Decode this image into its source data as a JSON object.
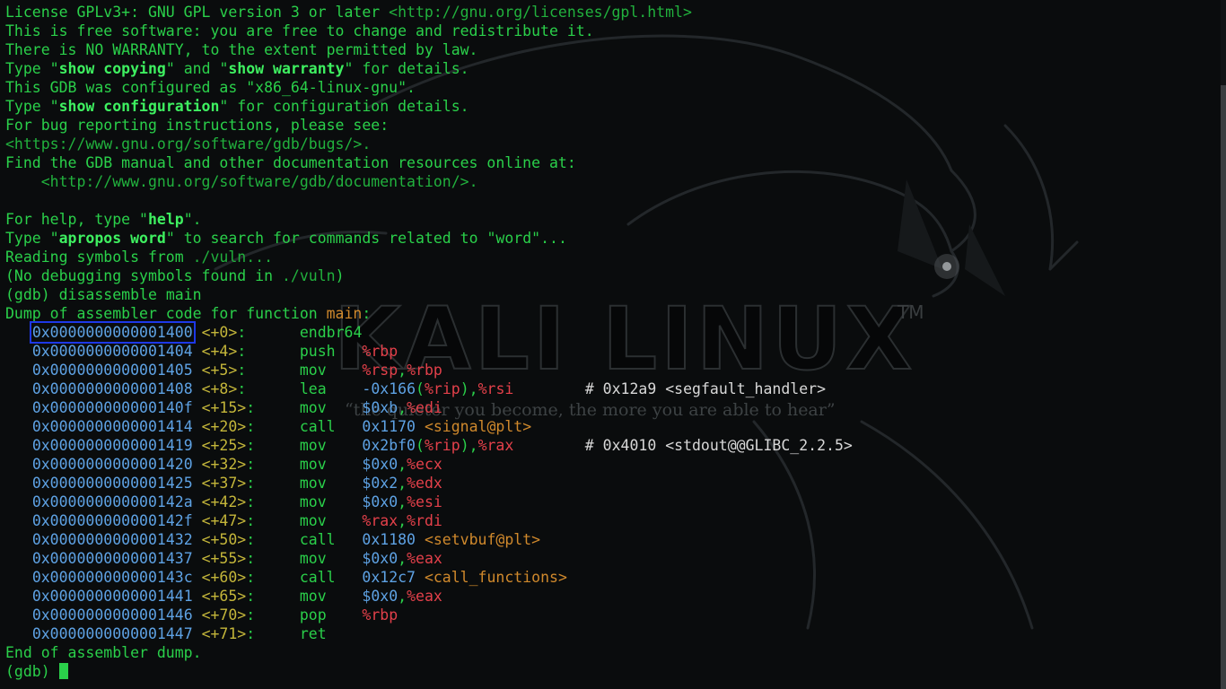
{
  "watermark": {
    "text": "KALI LINUX",
    "tm": "TM",
    "quote": "“the quieter you become, the more you are able to hear”"
  },
  "intro_lines": [
    "License GPLv3+: GNU GPL version 3 or later <http://gnu.org/licenses/gpl.html>",
    "This is free software: you are free to change and redistribute it.",
    "There is NO WARRANTY, to the extent permitted by law.",
    "Type \"show copying\" and \"show warranty\" for details.",
    "This GDB was configured as \"x86_64-linux-gnu\".",
    "Type \"show configuration\" for configuration details.",
    "For bug reporting instructions, please see:",
    "<https://www.gnu.org/software/gdb/bugs/>.",
    "Find the GDB manual and other documentation resources online at:",
    "    <http://www.gnu.org/software/gdb/documentation/>.",
    "",
    "For help, type \"help\".",
    "Type \"apropos word\" to search for commands related to \"word\"...",
    "Reading symbols from ./vuln...",
    "(No debugging symbols found in ./vuln)"
  ],
  "prompt": "(gdb)",
  "command": "disassemble main",
  "dump_header": "Dump of assembler code for function main:",
  "instructions": [
    {
      "addr": "0x0000000000001400",
      "off": "<+0>:",
      "mnemonic": "endbr64",
      "operands": "",
      "comment": ""
    },
    {
      "addr": "0x0000000000001404",
      "off": "<+4>:",
      "mnemonic": "push",
      "operands": "%rbp",
      "comment": ""
    },
    {
      "addr": "0x0000000000001405",
      "off": "<+5>:",
      "mnemonic": "mov",
      "operands": "%rsp,%rbp",
      "comment": ""
    },
    {
      "addr": "0x0000000000001408",
      "off": "<+8>:",
      "mnemonic": "lea",
      "operands": "-0x166(%rip),%rsi",
      "comment": "# 0x12a9 <segfault_handler>"
    },
    {
      "addr": "0x000000000000140f",
      "off": "<+15>:",
      "mnemonic": "mov",
      "operands": "$0xb,%edi",
      "comment": ""
    },
    {
      "addr": "0x0000000000001414",
      "off": "<+20>:",
      "mnemonic": "call",
      "operands": "0x1170 <signal@plt>",
      "comment": ""
    },
    {
      "addr": "0x0000000000001419",
      "off": "<+25>:",
      "mnemonic": "mov",
      "operands": "0x2bf0(%rip),%rax",
      "comment": "# 0x4010 <stdout@@GLIBC_2.2.5>"
    },
    {
      "addr": "0x0000000000001420",
      "off": "<+32>:",
      "mnemonic": "mov",
      "operands": "$0x0,%ecx",
      "comment": ""
    },
    {
      "addr": "0x0000000000001425",
      "off": "<+37>:",
      "mnemonic": "mov",
      "operands": "$0x2,%edx",
      "comment": ""
    },
    {
      "addr": "0x000000000000142a",
      "off": "<+42>:",
      "mnemonic": "mov",
      "operands": "$0x0,%esi",
      "comment": ""
    },
    {
      "addr": "0x000000000000142f",
      "off": "<+47>:",
      "mnemonic": "mov",
      "operands": "%rax,%rdi",
      "comment": ""
    },
    {
      "addr": "0x0000000000001432",
      "off": "<+50>:",
      "mnemonic": "call",
      "operands": "0x1180 <setvbuf@plt>",
      "comment": ""
    },
    {
      "addr": "0x0000000000001437",
      "off": "<+55>:",
      "mnemonic": "mov",
      "operands": "$0x0,%eax",
      "comment": ""
    },
    {
      "addr": "0x000000000000143c",
      "off": "<+60>:",
      "mnemonic": "call",
      "operands": "0x12c7 <call_functions>",
      "comment": ""
    },
    {
      "addr": "0x0000000000001441",
      "off": "<+65>:",
      "mnemonic": "mov",
      "operands": "$0x0,%eax",
      "comment": ""
    },
    {
      "addr": "0x0000000000001446",
      "off": "<+70>:",
      "mnemonic": "pop",
      "operands": "%rbp",
      "comment": ""
    },
    {
      "addr": "0x0000000000001447",
      "off": "<+71>:",
      "mnemonic": "ret",
      "operands": "",
      "comment": ""
    }
  ],
  "dump_footer": "End of assembler dump.",
  "final_prompt": "(gdb)",
  "highlight_address": "0x0000000000001400",
  "colors": {
    "text": "#2ad04a",
    "bold": "#3ef060",
    "address": "#5ea2e4",
    "register": "#e3404a",
    "offset": "#c4b63a",
    "symbol": "#d0892c",
    "comment": "#d8d8d8",
    "highlight_box": "#1d38e8",
    "background": "#0a0c0d"
  }
}
